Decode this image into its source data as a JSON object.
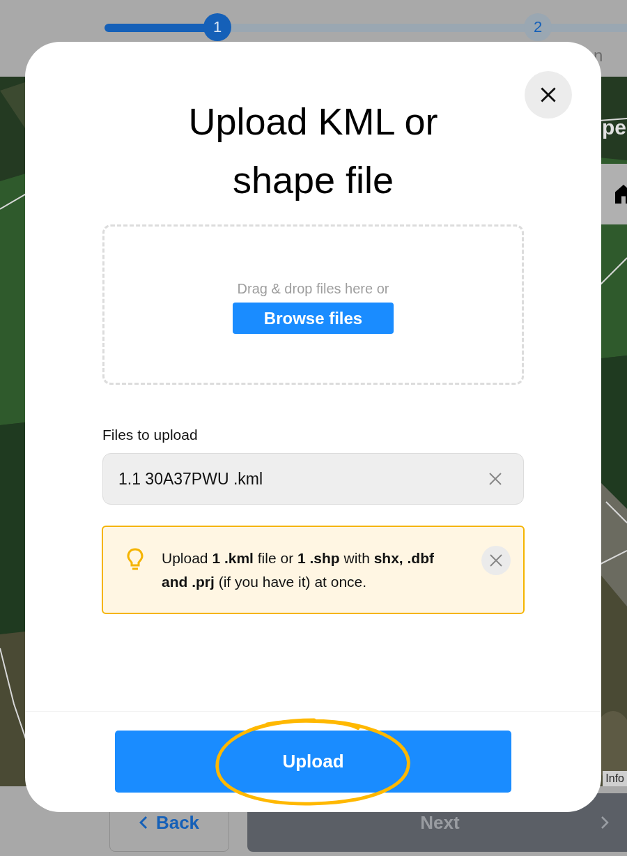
{
  "stepper": {
    "level": 0.21,
    "steps": [
      {
        "number": "1",
        "selected": true
      },
      {
        "number": "2",
        "selected": false
      }
    ],
    "step_label_fragment": "n"
  },
  "map": {
    "heading_fragment": "pe",
    "attribution": "Info"
  },
  "modal": {
    "title": "Upload KML or shape file",
    "dropzone": {
      "hint": "Drag & drop files here or",
      "button": "Browse files"
    },
    "files_label": "Files to upload",
    "files": [
      {
        "name": "1.1 30A37PWU .kml"
      }
    ],
    "tip": {
      "text": "Upload **1 .kml** file or **1 .shp** with **shx, .dbf and .prj** (if you have it) at once."
    },
    "submit": {
      "label": "Upload",
      "circled": true
    }
  },
  "footer_nav": {
    "back": "Back",
    "next": {
      "label": "Next",
      "disabled": true
    }
  }
}
